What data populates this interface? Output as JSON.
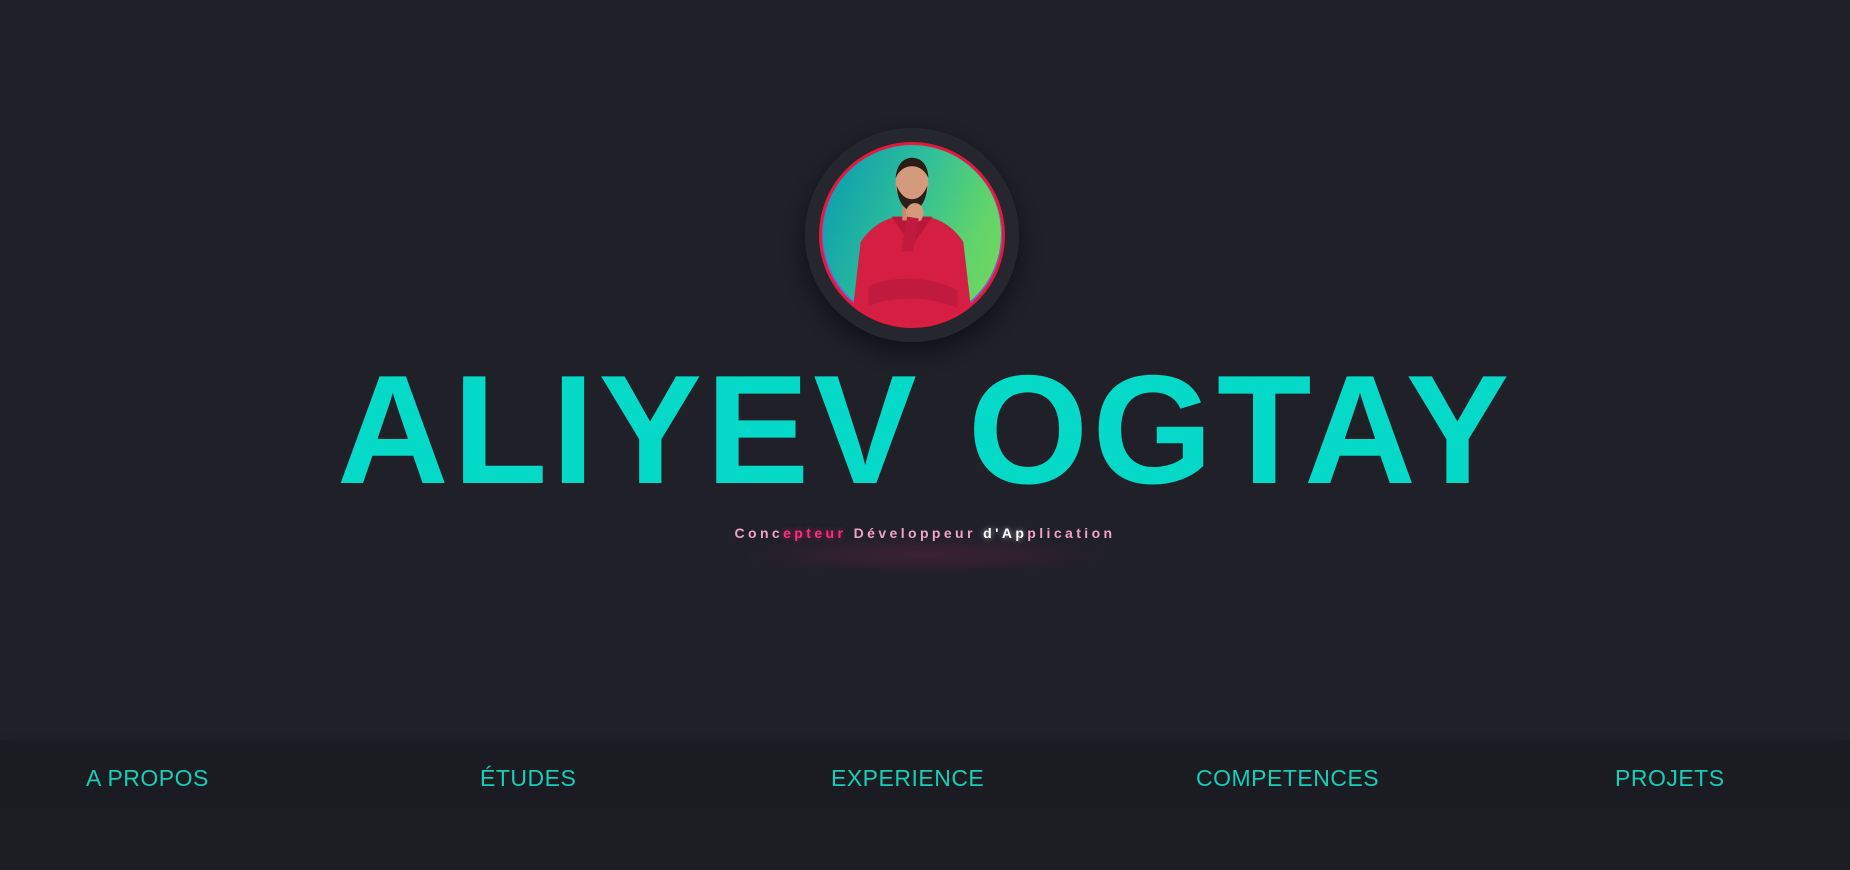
{
  "hero": {
    "name": "ALIYEV OGTAY",
    "tagline": "Concepteur Développeur d'Application",
    "avatar_alt": "profile-photo"
  },
  "nav": {
    "items": [
      {
        "label": "A PROPOS"
      },
      {
        "label": "ÉTUDES"
      },
      {
        "label": "EXPERIENCE"
      },
      {
        "label": "COMPETENCES"
      },
      {
        "label": "PROJETS"
      }
    ]
  },
  "colors": {
    "background": "#1f2027",
    "accent": "#05d9c7",
    "nav_text": "#16cdb9",
    "tagline_pink": "#ff2d78",
    "avatar_border": "#e21a3d"
  }
}
